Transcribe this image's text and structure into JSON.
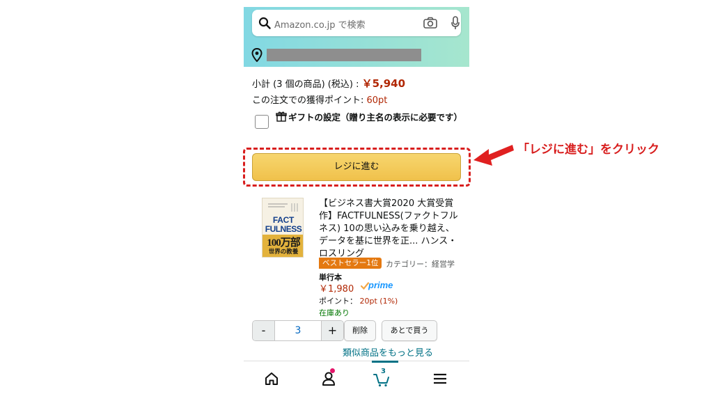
{
  "search": {
    "placeholder": "Amazon.co.jp で検索"
  },
  "cart": {
    "subtotal_label": "小計 (3 個の商品) (税込) : ",
    "subtotal_value": "￥5,940",
    "points_label": "この注文での獲得ポイント: ",
    "points_value": "60pt",
    "gift_label": "ギフトの設定（贈り主名の表示に必要です）",
    "checkout_button": "レジに進む"
  },
  "annotation": {
    "text": "「レジに進む」をクリック",
    "color": "#d81e1e"
  },
  "item": {
    "cover": {
      "line1": "FACT",
      "line2": "FULNESS",
      "line3": "100万部",
      "line4": "世界の教養"
    },
    "title": "【ビジネス書大賞2020 大賞受賞作】FACTFULNESS(ファクトフルネス) 10の思い込みを乗り越え、データを基に世界を正... ハンス・ロスリング",
    "badge": "ベストセラー1位",
    "category": "カテゴリー：経営学",
    "format": "単行本",
    "price": "￥1,980",
    "prime": "prime",
    "points_label": "ポイント： ",
    "points_value": "20pt (1%)",
    "stock": "在庫あり",
    "quantity": "3",
    "minus": "-",
    "plus": "+",
    "delete_button": "削除",
    "save_later_button": "あとで買う",
    "more_link": "類似商品をもっと見る"
  },
  "tabbar": {
    "cart_count": "3",
    "icons": [
      "home-icon",
      "user-icon",
      "cart-icon",
      "menu-icon"
    ]
  },
  "colors": {
    "accent": "#007185",
    "price": "#b12704",
    "checkout": "#f0c14b",
    "annotation": "#d81e1e"
  }
}
